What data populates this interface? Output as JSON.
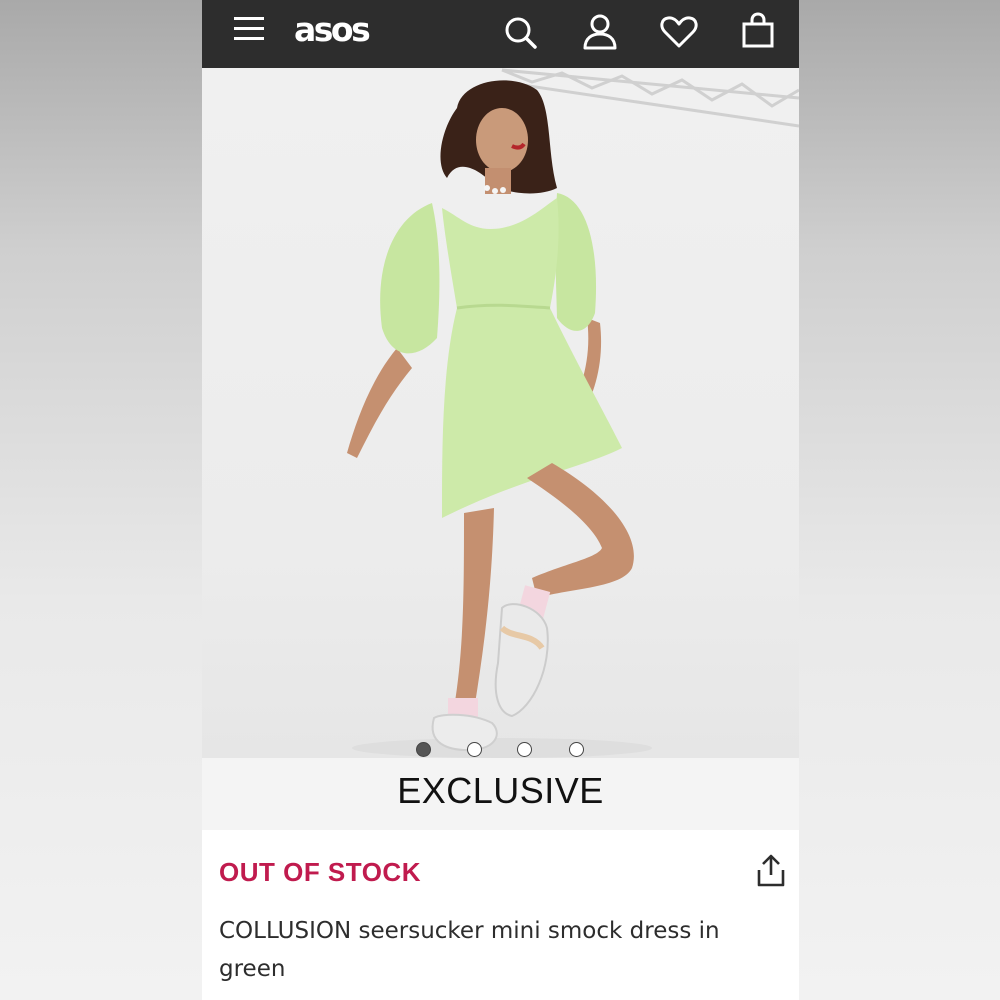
{
  "header": {
    "logo_text": "asos",
    "icons": [
      "menu-icon",
      "search-icon",
      "account-icon",
      "heart-icon",
      "bag-icon"
    ],
    "background": "#2d2d2d"
  },
  "gallery": {
    "image_count": 4,
    "active_index": 0,
    "badge": "EXCLUSIVE"
  },
  "product": {
    "stock_status": "OUT OF STOCK",
    "stock_color": "#c01b4e",
    "name": "COLLUSION seersucker mini smock dress in green"
  }
}
